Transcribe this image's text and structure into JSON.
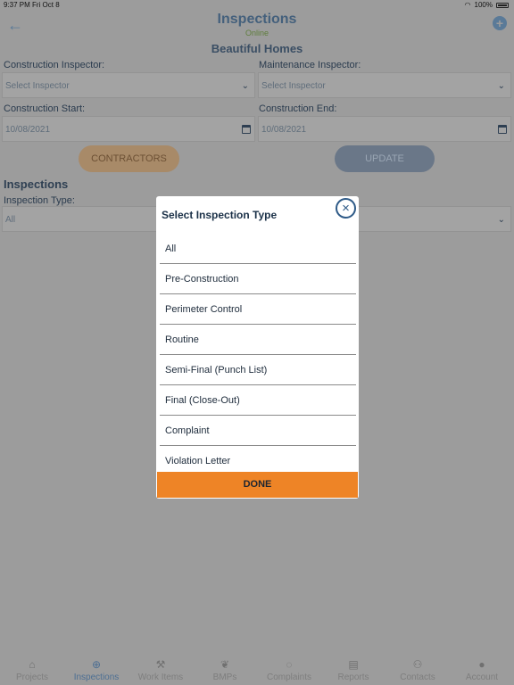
{
  "status_bar": {
    "time": "9:37 PM",
    "date": "Fri Oct 8",
    "battery": "100%"
  },
  "header": {
    "title": "Inspections",
    "subtitle": "Online",
    "project": "Beautiful Homes"
  },
  "form": {
    "construction_inspector_label": "Construction Inspector:",
    "construction_inspector_placeholder": "Select Inspector",
    "maintenance_inspector_label": "Maintenance Inspector:",
    "maintenance_inspector_placeholder": "Select Inspector",
    "construction_start_label": "Construction Start:",
    "construction_start_value": "10/08/2021",
    "construction_end_label": "Construction End:",
    "construction_end_value": "10/08/2021",
    "contractors_button": "CONTRACTORS",
    "update_button": "UPDATE"
  },
  "inspections": {
    "title": "Inspections",
    "type_label": "Inspection Type:",
    "type_value": "All"
  },
  "modal": {
    "title": "Select Inspection Type",
    "options": [
      "All",
      "Pre-Construction",
      "Perimeter Control",
      "Routine",
      "Semi-Final (Punch List)",
      "Final (Close-Out)",
      "Complaint",
      "Violation Letter"
    ],
    "done_label": "DONE"
  },
  "tabs": [
    {
      "label": "Projects",
      "icon": "home-icon",
      "glyph": "⌂"
    },
    {
      "label": "Inspections",
      "icon": "binoculars-icon",
      "glyph": "⊕",
      "active": true
    },
    {
      "label": "Work Items",
      "icon": "hammer-icon",
      "glyph": "⚒"
    },
    {
      "label": "BMPs",
      "icon": "leaf-icon",
      "glyph": "❦"
    },
    {
      "label": "Complaints",
      "icon": "chat-icon",
      "glyph": "◌"
    },
    {
      "label": "Reports",
      "icon": "document-icon",
      "glyph": "▤"
    },
    {
      "label": "Contacts",
      "icon": "people-icon",
      "glyph": "⚇"
    },
    {
      "label": "Account",
      "icon": "account-icon",
      "glyph": "●"
    }
  ],
  "colors": {
    "accent_orange": "#ee8426",
    "accent_blue": "#2e5a87",
    "overlay": "#9c9c9c"
  }
}
